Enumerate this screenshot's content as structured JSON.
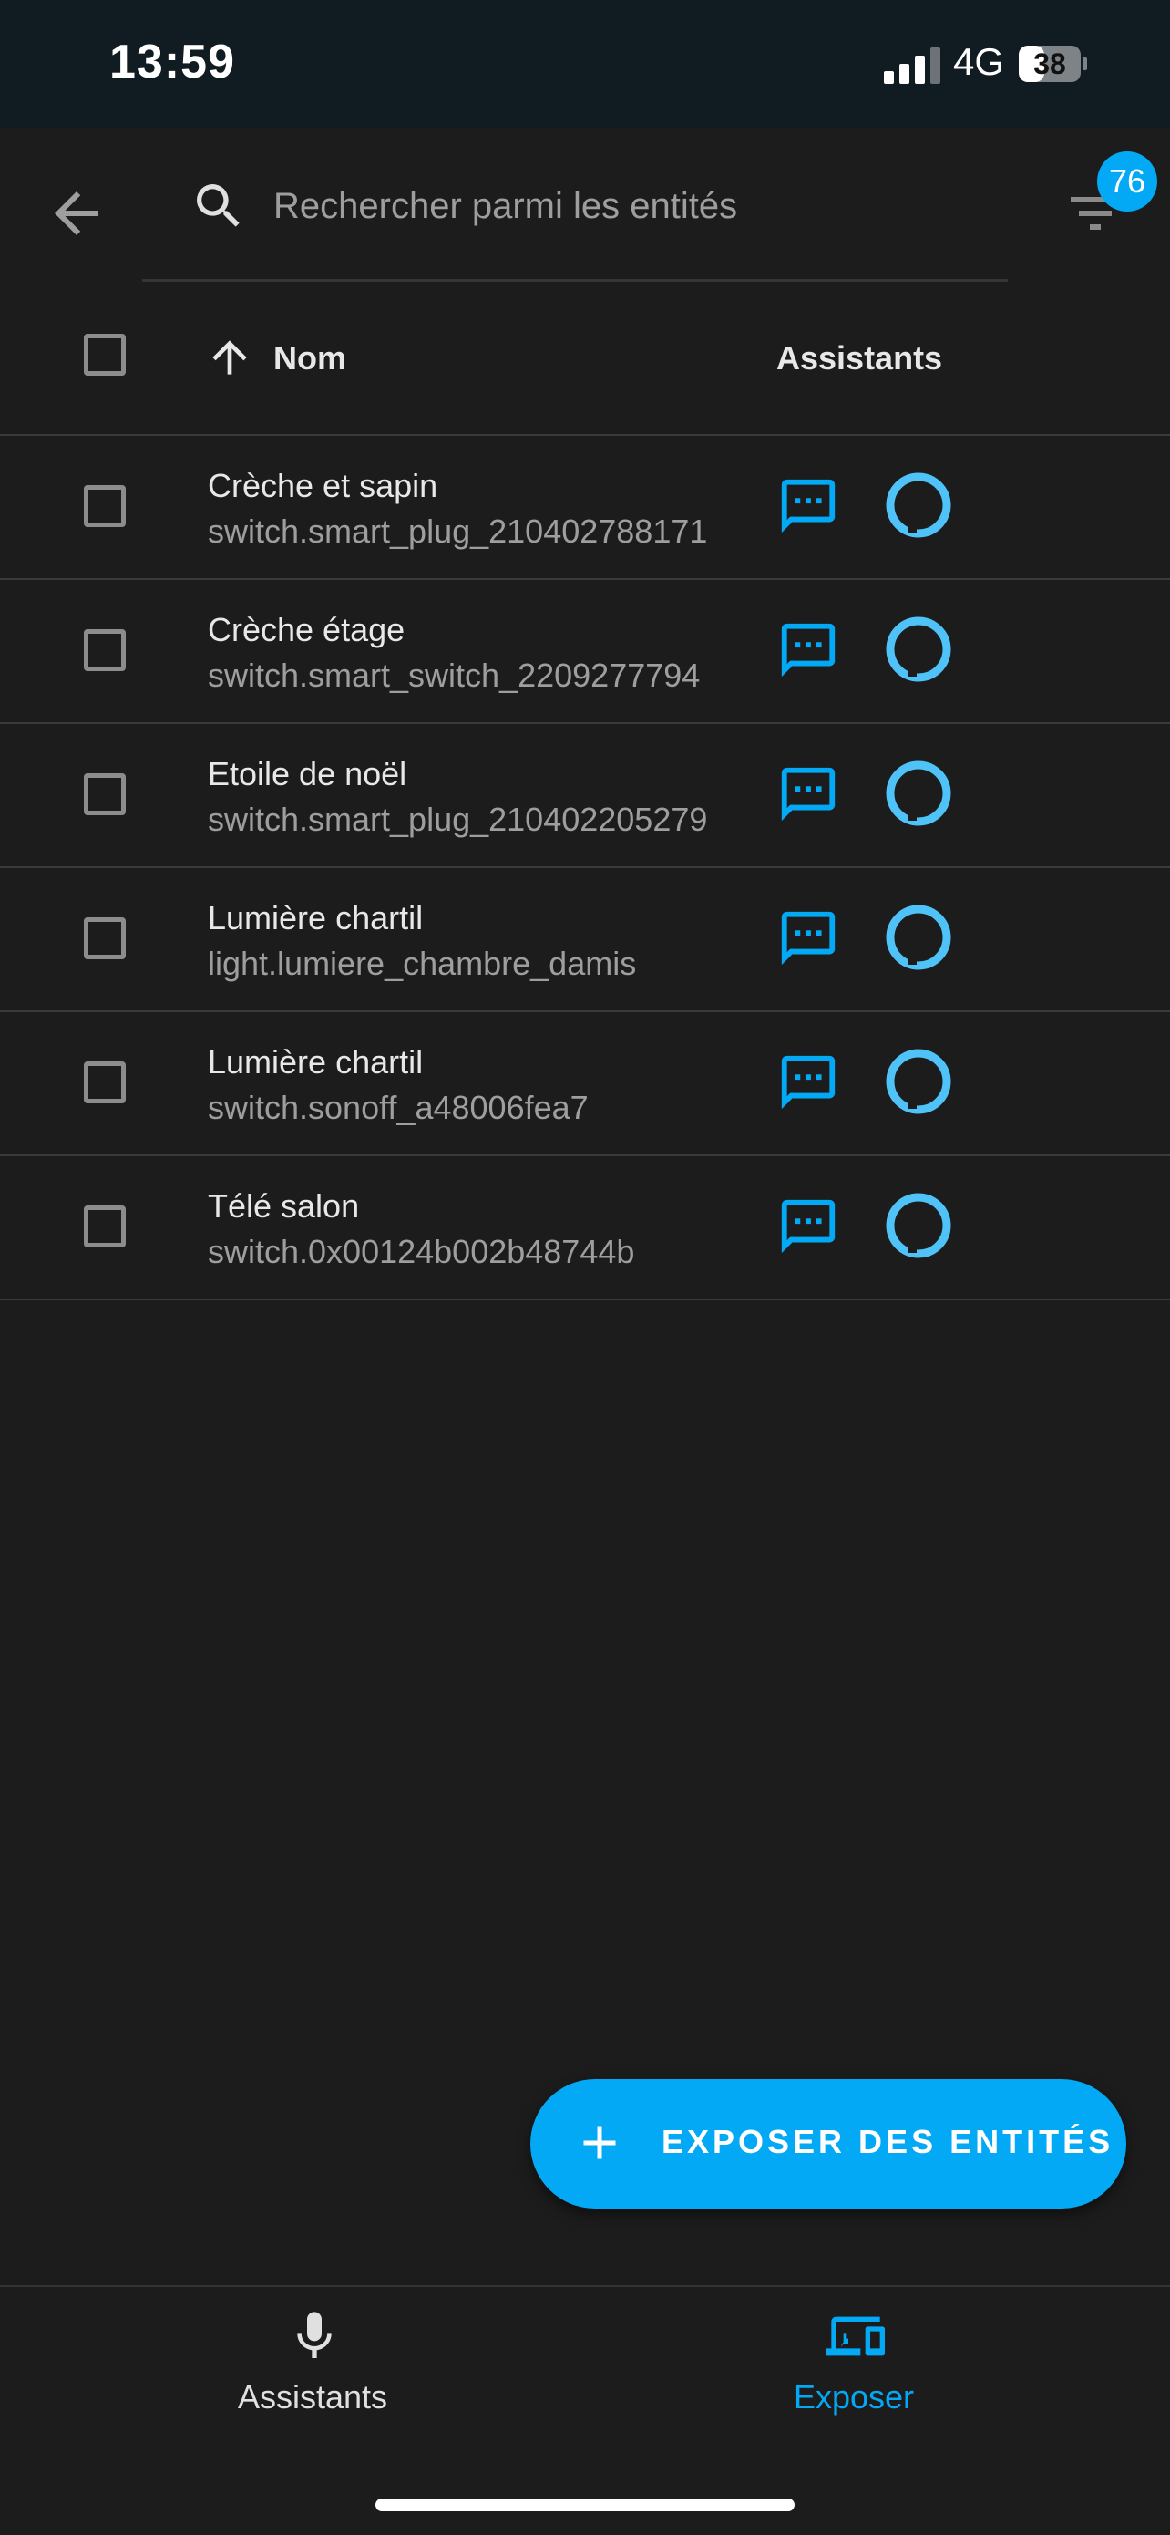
{
  "status_bar": {
    "time": "13:59",
    "network": "4G",
    "battery": "38"
  },
  "search": {
    "placeholder": "Rechercher parmi les entités",
    "value": ""
  },
  "filter": {
    "badge_count": "76"
  },
  "table": {
    "columns": {
      "name": "Nom",
      "assistants": "Assistants"
    },
    "rows": [
      {
        "name": "Crèche et sapin",
        "entity_id": "switch.smart_plug_210402788171"
      },
      {
        "name": "Crèche étage",
        "entity_id": "switch.smart_switch_2209277794"
      },
      {
        "name": "Etoile de noël",
        "entity_id": "switch.smart_plug_210402205279"
      },
      {
        "name": "Lumière chartil",
        "entity_id": "light.lumiere_chambre_damis"
      },
      {
        "name": "Lumière chartil",
        "entity_id": "switch.sonoff_a48006fea7"
      },
      {
        "name": "Télé salon",
        "entity_id": "switch.0x00124b002b48744b"
      }
    ]
  },
  "fab": {
    "label": "EXPOSER DES ENTITÉS",
    "icon": "plus-icon"
  },
  "bottom_nav": {
    "items": [
      {
        "label": "Assistants",
        "icon": "microphone-icon",
        "active": false
      },
      {
        "label": "Exposer",
        "icon": "devices-icon",
        "active": true
      }
    ]
  },
  "colors": {
    "accent": "#03a9f4",
    "alexa": "#4fc3f7",
    "background": "#1c1c1c",
    "status_bar": "#101b22"
  },
  "icons": {
    "assist": "assist-chat-icon",
    "alexa": "alexa-icon",
    "back": "arrow-left-icon",
    "search": "search-icon",
    "filter": "filter-icon",
    "sort": "arrow-up-icon"
  }
}
